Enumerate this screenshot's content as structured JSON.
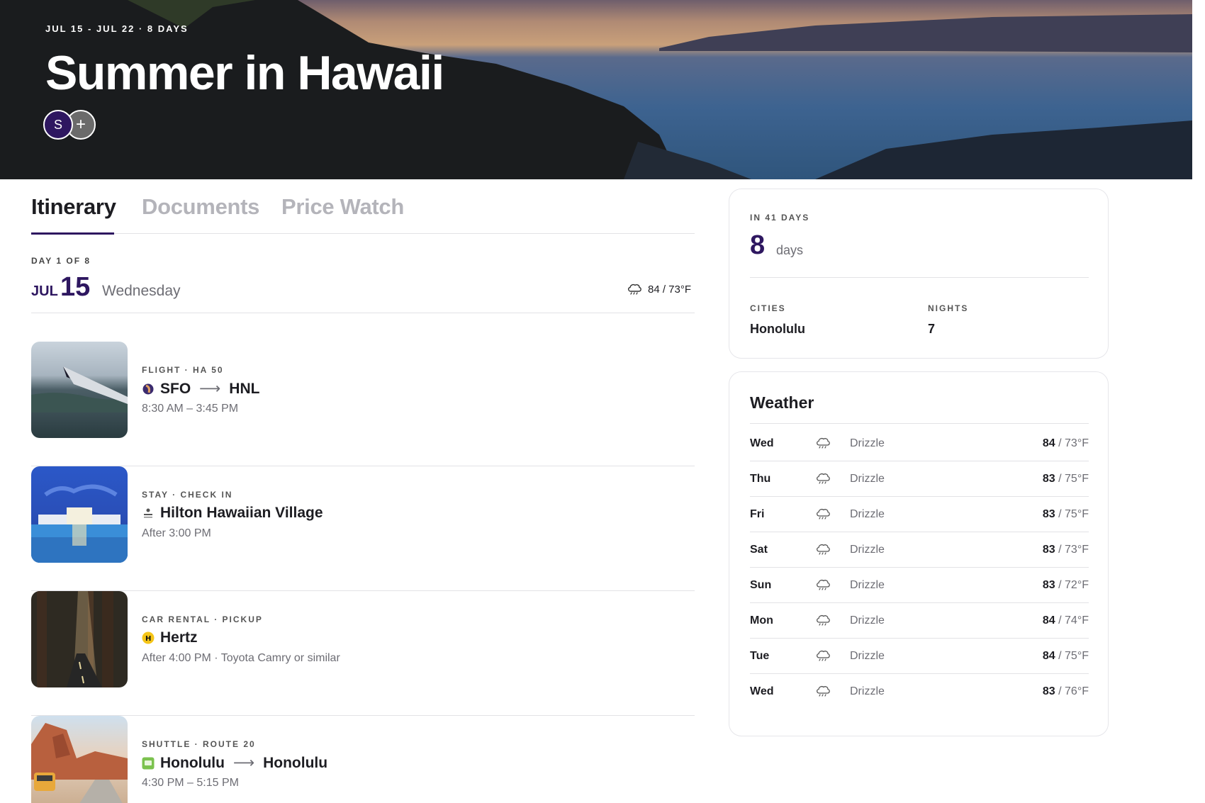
{
  "trip": {
    "dates": "JUL 15 - JUL 22 · 8 DAYS",
    "title": "Summer in Hawaii",
    "avatar_initial": "S",
    "add_member": "+"
  },
  "tabs": [
    {
      "label": "Itinerary",
      "active": true
    },
    {
      "label": "Documents",
      "active": false
    },
    {
      "label": "Price Watch",
      "active": false
    }
  ],
  "day": {
    "day_of": "DAY 1 OF 8",
    "month": "JUL",
    "date": "15",
    "weekday": "Wednesday",
    "weather_icon": "rain-cloud-icon",
    "weather": "84 / 73°F"
  },
  "items": [
    {
      "kind": "FLIGHT · HA 50",
      "logo": "hawaiian-airlines-logo",
      "from": "SFO",
      "arrow": "⟶",
      "to": "HNL",
      "sub": "8:30 AM – 3:45 PM",
      "thumb": "airplane-wing-photo"
    },
    {
      "kind": "STAY · CHECK IN",
      "logo": "hilton-logo",
      "title": "Hilton Hawaiian Village",
      "sub": "After 3:00 PM",
      "thumb": "hotel-pool-photo"
    },
    {
      "kind": "CAR RENTAL · PICKUP",
      "logo": "hertz-logo",
      "title": "Hertz",
      "sub": "After 4:00 PM · Toyota Camry or similar",
      "thumb": "forest-road-photo"
    },
    {
      "kind": "SHUTTLE · ROUTE 20",
      "logo": "shuttle-logo",
      "from": "Honolulu",
      "arrow": "⟶",
      "to": "Honolulu",
      "sub": "4:30 PM – 5:15 PM",
      "thumb": "desert-van-photo"
    }
  ],
  "summary": {
    "countdown": "IN 41 DAYS",
    "length": "8",
    "length_unit": "days",
    "cities_label": "CITIES",
    "cities": "Honolulu",
    "nights_label": "NIGHTS",
    "nights": "7"
  },
  "weather": {
    "title": "Weather",
    "icon": "rain-cloud-icon",
    "days": [
      {
        "day": "Wed",
        "cond": "Drizzle",
        "high": "84",
        "low": " / 73°F"
      },
      {
        "day": "Thu",
        "cond": "Drizzle",
        "high": "83",
        "low": " / 75°F"
      },
      {
        "day": "Fri",
        "cond": "Drizzle",
        "high": "83",
        "low": " / 75°F"
      },
      {
        "day": "Sat",
        "cond": "Drizzle",
        "high": "83",
        "low": " / 73°F"
      },
      {
        "day": "Sun",
        "cond": "Drizzle",
        "high": "83",
        "low": " / 72°F"
      },
      {
        "day": "Mon",
        "cond": "Drizzle",
        "high": "84",
        "low": " / 74°F"
      },
      {
        "day": "Tue",
        "cond": "Drizzle",
        "high": "84",
        "low": " / 75°F"
      },
      {
        "day": "Wed",
        "cond": "Drizzle",
        "high": "83",
        "low": " / 76°F"
      }
    ]
  },
  "colors": {
    "accent": "#2e1760",
    "muted": "#6d6d74",
    "rule": "#e2e2e6"
  }
}
